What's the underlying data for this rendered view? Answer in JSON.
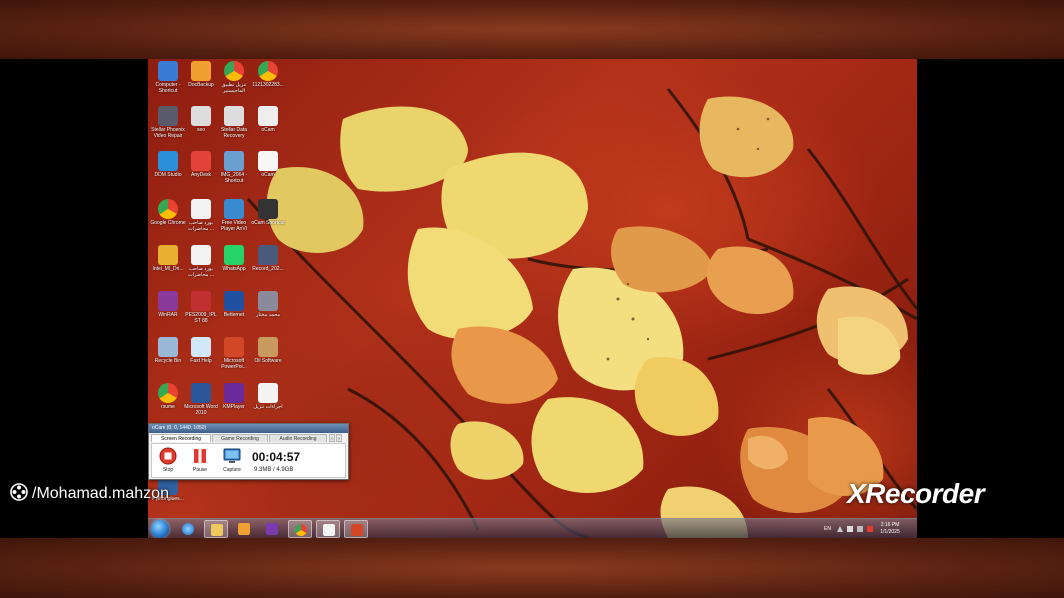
{
  "desktop_icons": [
    {
      "label": "Computer - Shortcut",
      "icon": "computer-icon",
      "color": "#3a7bd5"
    },
    {
      "label": "DocBackup",
      "icon": "folder-doc-icon",
      "color": "#f0a030"
    },
    {
      "label": "تنزيل تطبيق الماجيستير",
      "icon": "chrome-icon",
      "color": "#e94235"
    },
    {
      "label": "1121302283...",
      "icon": "chrome-icon",
      "color": "#e94235"
    },
    {
      "label": "Stellar Phoenix Video Repair",
      "icon": "app-icon",
      "color": "#5a5a6a"
    },
    {
      "label": "seo",
      "icon": "file-icon",
      "color": "#dddddd"
    },
    {
      "label": "Stellar Data Recovery",
      "icon": "app-icon",
      "color": "#dddddd"
    },
    {
      "label": "oCam",
      "icon": "file-icon",
      "color": "#eeeeee"
    },
    {
      "label": "DDM Studio",
      "icon": "music-icon",
      "color": "#2a8fd8"
    },
    {
      "label": "AnyDesk",
      "icon": "anydesk-icon",
      "color": "#e2443a"
    },
    {
      "label": "IMG_2064 - Shortcut",
      "icon": "image-icon",
      "color": "#6aa0d0"
    },
    {
      "label": "oCam",
      "icon": "ocam-icon",
      "color": "#f7f7f7"
    },
    {
      "label": "Google Chrome",
      "icon": "chrome-icon",
      "color": "#e94235"
    },
    {
      "label": "بورد صاحب محاضرات ...",
      "icon": "document-icon",
      "color": "#f4f4f4"
    },
    {
      "label": "Free Video Player AnVI",
      "icon": "player-icon",
      "color": "#3a8ad0"
    },
    {
      "label": "oCam Shortcut",
      "icon": "camera-icon",
      "color": "#333333"
    },
    {
      "label": "Intel_MI_Dri...",
      "icon": "installer-icon",
      "color": "#e8b030"
    },
    {
      "label": "بورد صاحب محاضرات ...",
      "icon": "document-icon",
      "color": "#f4f4f4"
    },
    {
      "label": "WhatsApp",
      "icon": "whatsapp-icon",
      "color": "#25d366"
    },
    {
      "label": "Record_202...",
      "icon": "mp4-icon",
      "color": "#4a5a7a"
    },
    {
      "label": "WinRAR",
      "icon": "winrar-icon",
      "color": "#8a3a9a"
    },
    {
      "label": "PES2009_IPL ST 88",
      "icon": "game-icon",
      "color": "#c03030"
    },
    {
      "label": "Betternet",
      "icon": "betternet-icon",
      "color": "#2050a0"
    },
    {
      "label": "محمد مختار",
      "icon": "mail-icon",
      "color": "#8a8a9a"
    },
    {
      "label": "Recycle Bin",
      "icon": "recycle-bin-icon",
      "color": "#9ab8d8"
    },
    {
      "label": "Fast Help",
      "icon": "help-icon",
      "color": "#d0e8f8"
    },
    {
      "label": "Microsoft PowerPoi...",
      "icon": "powerpoint-icon",
      "color": "#d24726"
    },
    {
      "label": "Oil Software",
      "icon": "app-icon",
      "color": "#c89a60"
    },
    {
      "label": "rsume",
      "icon": "chrome-icon",
      "color": "#e94235"
    },
    {
      "label": "Microsoft Word 2010",
      "icon": "word-icon",
      "color": "#2b579a"
    },
    {
      "label": "KMPlayer",
      "icon": "kmplayer-icon",
      "color": "#6a2a9a"
    },
    {
      "label": "اجراءات تنزيل",
      "icon": "document-icon",
      "color": "#f4f4f4"
    },
    {
      "label": "Pythonglues...",
      "icon": "cube-icon",
      "color": "#3060a0"
    }
  ],
  "ocam": {
    "title": "oCam (0, 0, 1440, 1050)",
    "tabs": [
      "Screen Recording",
      "Game Recording",
      "Audio Recording"
    ],
    "active_tab": "Screen Recording",
    "tools": [
      "Stop",
      "Pause",
      "Capture"
    ],
    "elapsed": "00:04:57",
    "size": "9.3MB / 4.9GB"
  },
  "taskbar": {
    "pinned": [
      "internet-explorer-icon",
      "file-explorer-icon",
      "media-player-icon",
      "visual-studio-icon",
      "chrome-icon",
      "notepad-icon",
      "powerpoint-icon"
    ],
    "language": "EN",
    "time": "2:16 PM",
    "date": "1/1/2025"
  },
  "overlay": {
    "username": "/Mohamad.mahzon",
    "recorder": "XRecorder"
  }
}
